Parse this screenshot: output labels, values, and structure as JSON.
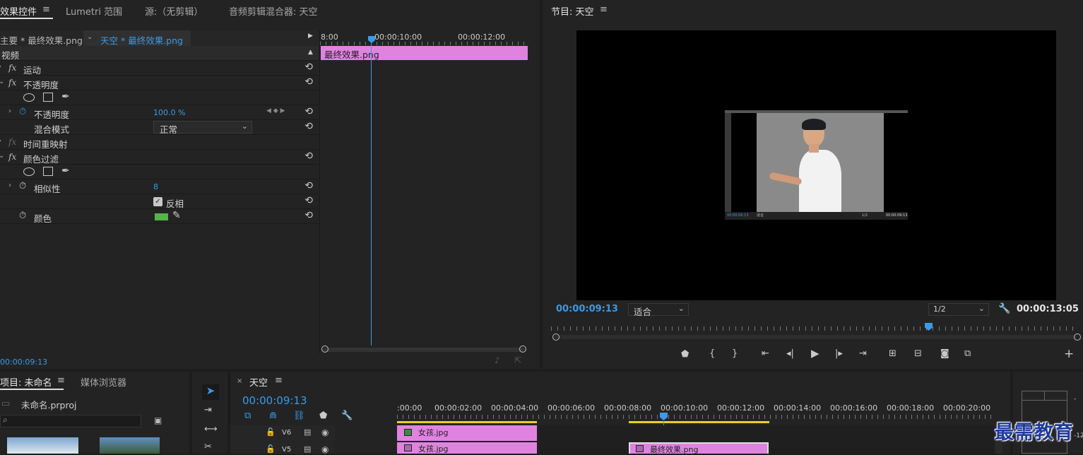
{
  "effect_controls": {
    "tabs": [
      "效果控件",
      "Lumetri 范围",
      "源:（无剪辑）",
      "音频剪辑混合器: 天空"
    ],
    "menu_icon": "hamburger-icon",
    "master_clip": "主要 * 最终效果.png",
    "sequence_clip": "天空 * 最终效果.png",
    "section_video": "视频",
    "fx_symbol": "fx",
    "rows": {
      "motion": "运动",
      "opacity": "不透明度",
      "opacity_param": "不透明度",
      "opacity_value": "100.0 %",
      "blend_mode": "混合模式",
      "blend_value": "正常",
      "time_remap": "时间重映射",
      "color_key": "颜色过滤",
      "similarity": "相似性",
      "similarity_value": "8",
      "invert": "反相",
      "color": "颜色",
      "color_swatch": "#52b548"
    },
    "timecode": "00:00:09:13",
    "mini_timeline": {
      "ticks": [
        "8:00",
        "00:00:10:00",
        "00:00:12:00"
      ],
      "clip": "最终效果.png",
      "clip_color": "#e083e0"
    }
  },
  "program": {
    "title": "节目: 天空",
    "timecode": "00:00:09:13",
    "fit": "适合",
    "resolution": "1/2",
    "duration": "00:00:13:05",
    "buttons": [
      "marker-icon",
      "in-point-icon",
      "out-point-icon",
      "go-to-in-icon",
      "step-back-icon",
      "play-icon",
      "step-forward-icon",
      "go-to-out-icon",
      "lift-icon",
      "extract-icon",
      "export-frame-icon",
      "comparison-icon",
      "add-icon"
    ],
    "nested": {
      "timecode": "00:00:09:13",
      "fit": "适合",
      "res": "1/2",
      "dur": "00:00:09:13"
    }
  },
  "project": {
    "tabs": [
      "项目: 未命名",
      "媒体浏览器"
    ],
    "file": "未命名.prproj",
    "search_placeholder": ""
  },
  "timeline": {
    "title": "天空",
    "timecode": "00:00:09:13",
    "ticks": [
      ":00:00",
      "00:00:02:00",
      "00:00:04:00",
      "00:00:06:00",
      "00:00:08:00",
      "00:00:10:00",
      "00:00:12:00",
      "00:00:14:00",
      "00:00:16:00",
      "00:00:18:00",
      "00:00:20:00"
    ],
    "tracks": [
      {
        "name": "V6",
        "clip": "女孩.jpg"
      },
      {
        "name": "V5",
        "clip": "女孩.jpg",
        "clip2": "最终效果.png"
      }
    ]
  },
  "watermark": "最需教育",
  "meter": {
    "labels": [
      "-",
      "-12"
    ]
  }
}
